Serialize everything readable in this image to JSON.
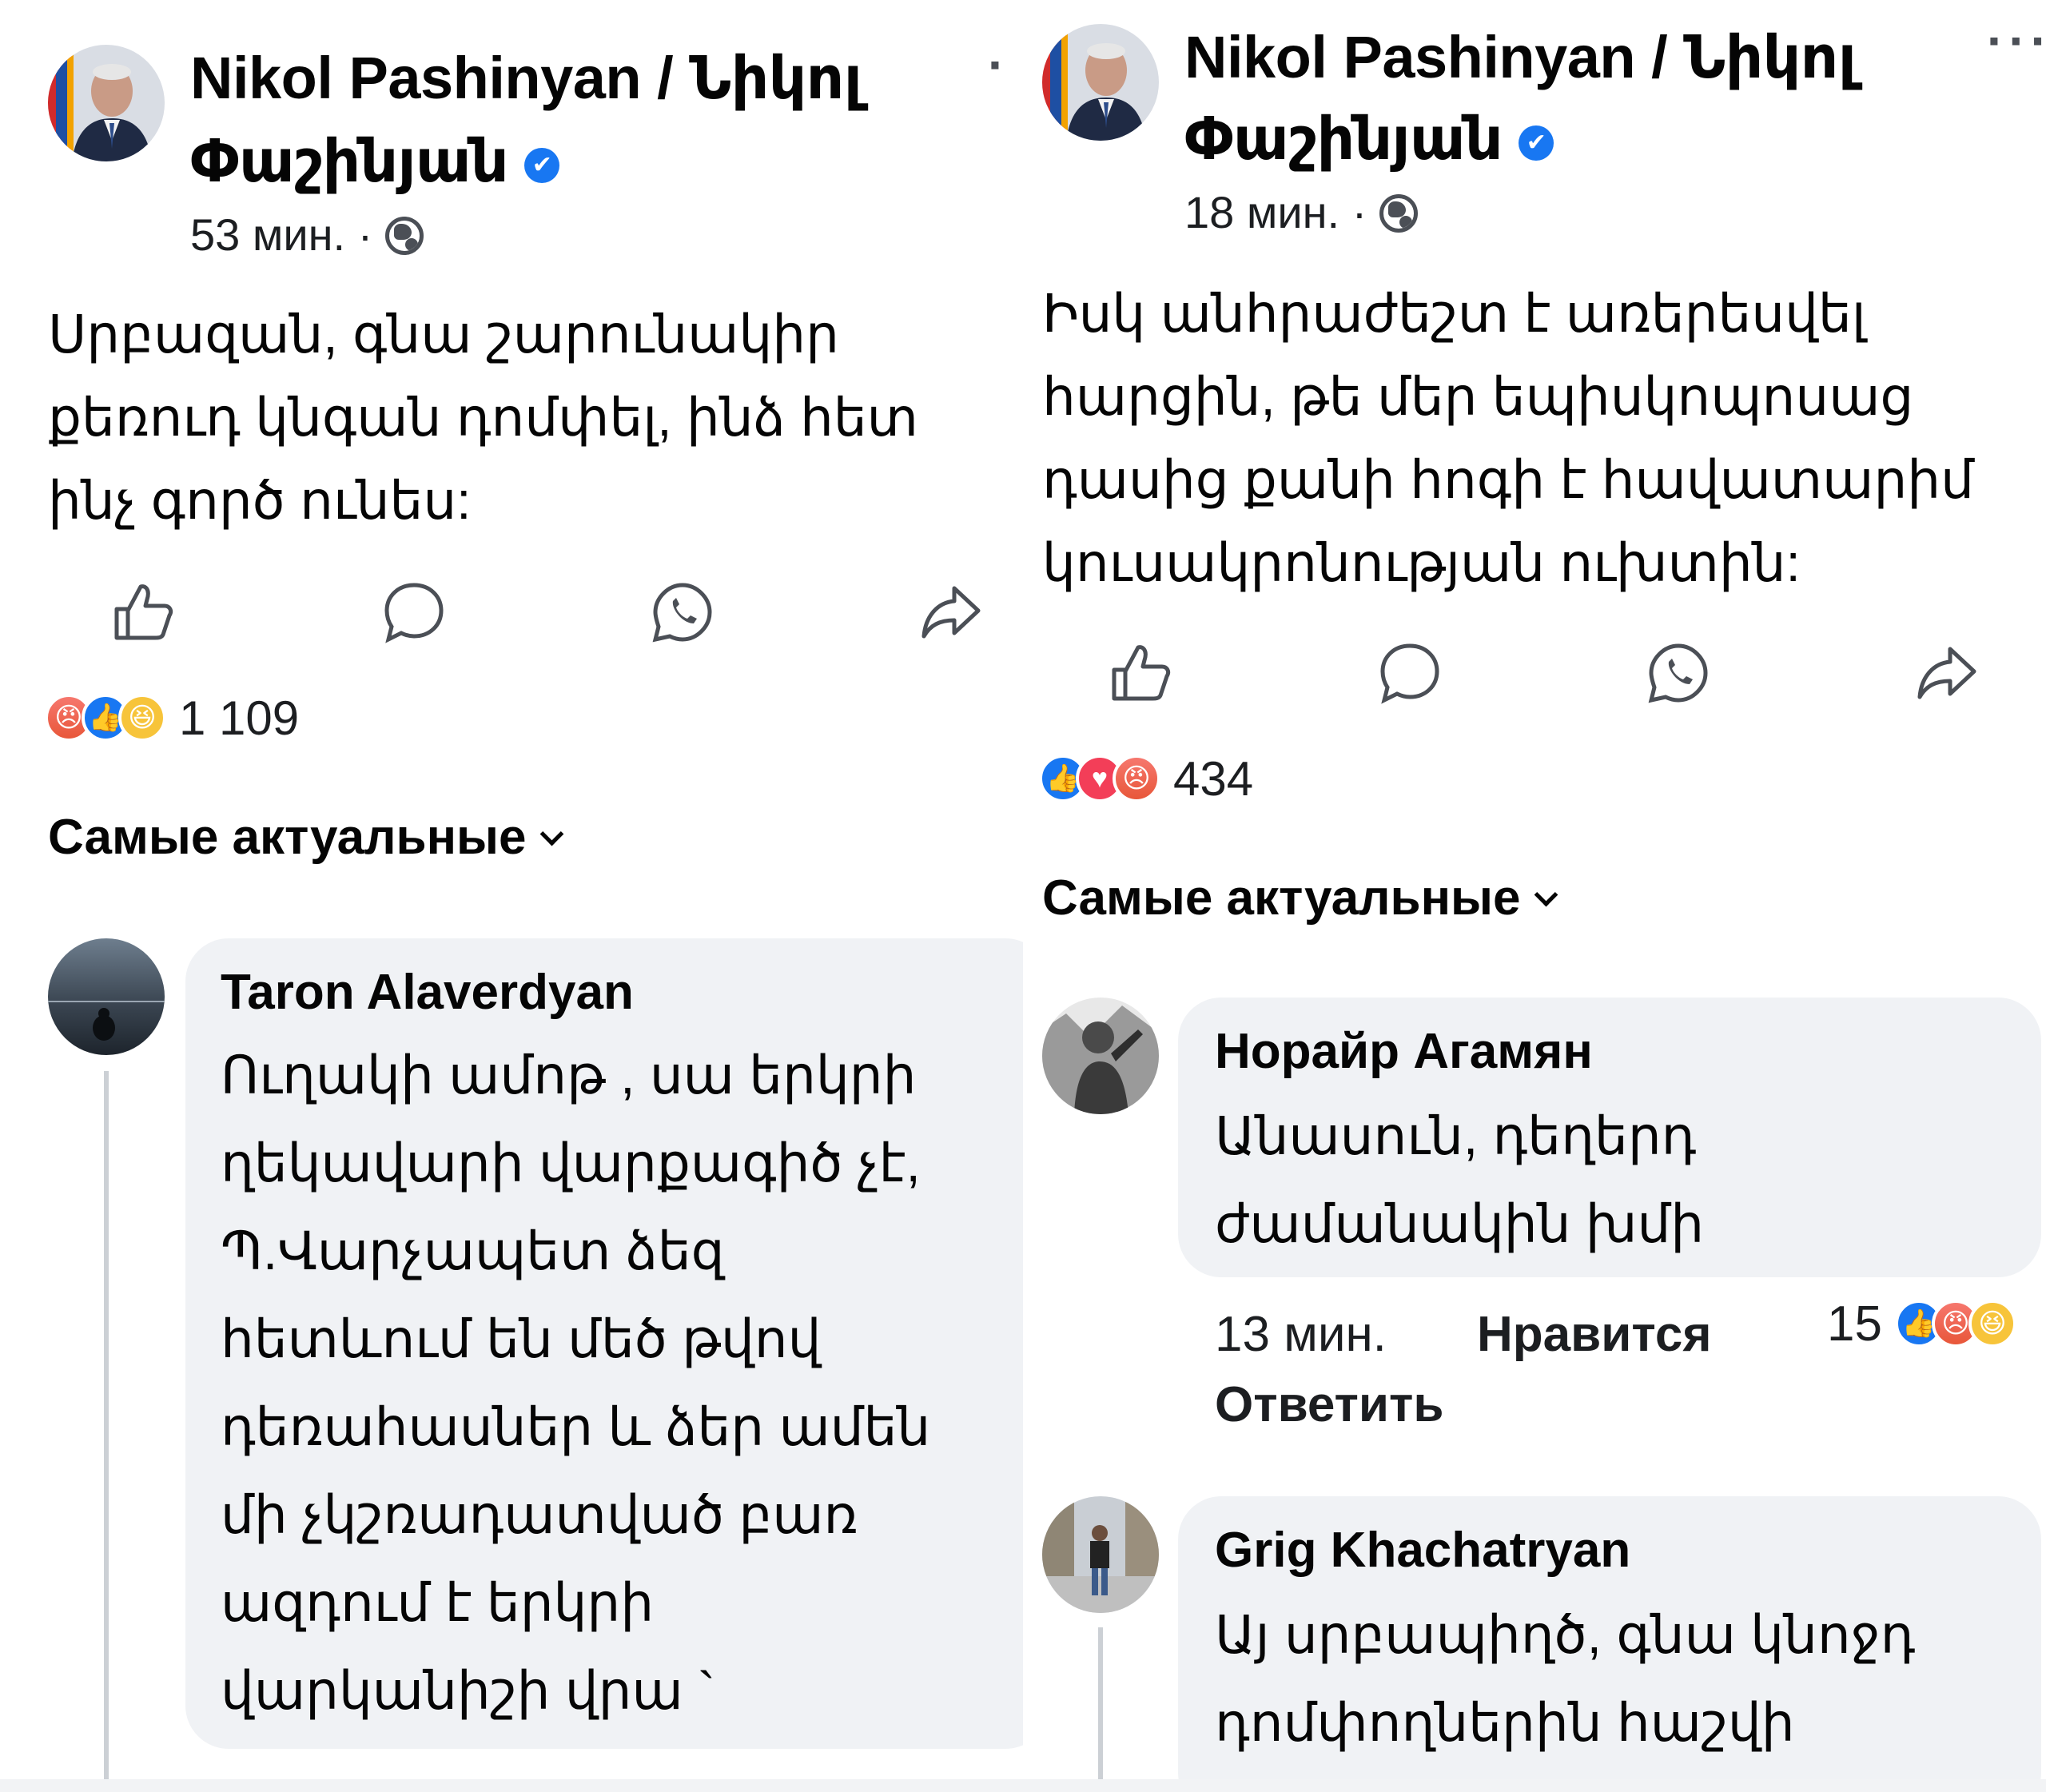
{
  "left": {
    "author": "Nikol Pashinyan / Նիկոլ",
    "author_line2": "Փաշինյան",
    "time": "53 мин. ·",
    "post_lines": "Սրբազան, գնա շարունակիր\nքեռուդ կնգան դոմփել, ինձ հետ\nինչ գործ ունես:",
    "reaction_count": "1 109",
    "sort": "Самые актуальные",
    "comment": {
      "name": "Taron Alaverdyan",
      "text": "Ուղակի ամոթ , սա երկրի\nղեկավարի վարքագիծ չէ,\nՊ.Վարչապետ ձեզ\nհետևում են մեծ թվով\nդեռահասներ և ձեր ամեն\nմի չկշռադատված բառ\nազդում է երկրի\nվարկանիշի վրա `"
    }
  },
  "right": {
    "author": "Nikol Pashinyan / Նիկոլ",
    "author_line2": "Փաշինյան",
    "time": "18 мин. ·",
    "post_lines": "Իսկ անհրաժեշտ է առերեսվել\nհարցին, թե մեր եպիսկոպոսաց\nդասից քանի հոգի է հավատարիմ\nկուսակրոնության ուխտին:",
    "reaction_count": "434",
    "sort": "Самые актуальные",
    "comment1": {
      "name": "Норайр Агамян",
      "text": "Անասուն, դեղերդ\nժամանակին խմի",
      "time": "13 мин.",
      "like": "Нравится",
      "reply": "Ответить",
      "count": "15"
    },
    "comment2": {
      "name": "Grig Khachatryan",
      "text": "Այ սրբապիղծ, գնա կնոջդ\nդոմփողներին հաշվի"
    }
  },
  "colors": {
    "accent": "#1877f2",
    "bubble": "#f0f2f5",
    "text": "#050505"
  },
  "icons": [
    "like-icon",
    "comment-icon",
    "whatsapp-icon",
    "share-icon",
    "globe-icon",
    "verified-icon",
    "more-icon"
  ]
}
